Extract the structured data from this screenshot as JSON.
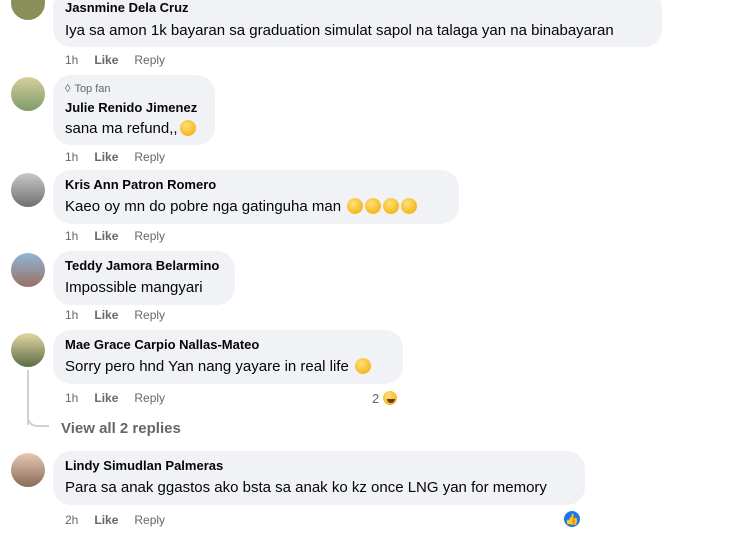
{
  "comments": [
    {
      "name": "Jasnmine Dela Cruz",
      "text": "Iya sa amon 1k bayaran sa graduation simulat sapol na talaga yan na binabayaran",
      "time": "1h",
      "like": "Like",
      "reply": "Reply"
    },
    {
      "name": "Julie Renido Jimenez",
      "badge": "Top fan",
      "text": "sana ma refund,,",
      "time": "1h",
      "like": "Like",
      "reply": "Reply"
    },
    {
      "name": "Kris Ann Patron Romero",
      "text": "Kaeo oy mn do pobre nga gatinguha man",
      "time": "1h",
      "like": "Like",
      "reply": "Reply"
    },
    {
      "name": "Teddy Jamora Belarmino",
      "text": "Impossible mangyari",
      "time": "1h",
      "like": "Like",
      "reply": "Reply"
    },
    {
      "name": "Mae Grace Carpio Nallas-Mateo",
      "text": "Sorry pero hnd Yan nang yayare in real life",
      "time": "1h",
      "like": "Like",
      "reply": "Reply",
      "reaction_count": "2"
    },
    {
      "name": "Lindy Simudlan Palmeras",
      "text": "Para sa anak ggastos ako bsta sa anak ko kz once LNG yan for memory",
      "time": "2h",
      "like": "Like",
      "reply": "Reply"
    }
  ],
  "view_replies": "View all 2 replies",
  "icons": {
    "top_fan": "diamond-icon",
    "haha": "haha-reaction-icon",
    "like": "like-reaction-icon"
  },
  "colors": {
    "bubble": "#f0f2f5",
    "meta": "#65676b",
    "like_blue": "#1877f2"
  }
}
